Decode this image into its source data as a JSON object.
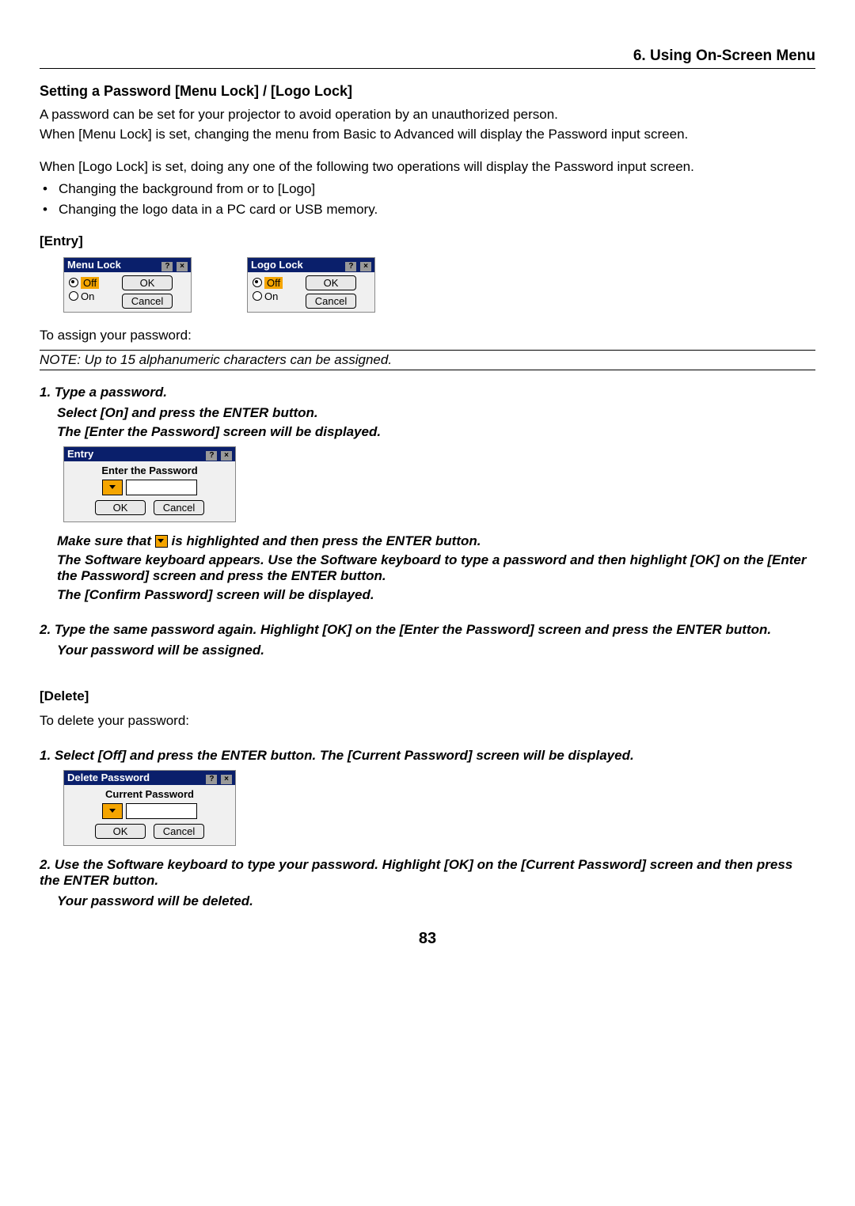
{
  "header": {
    "text": "6. Using On-Screen Menu"
  },
  "subtitle": "Setting a Password [Menu Lock] / [Logo Lock]",
  "intro": {
    "p1": "A password can be set for your projector to avoid operation by an unauthorized person.",
    "p2": "When [Menu Lock] is set, changing the menu from Basic to Advanced will display the Password input screen.",
    "p3": "When [Logo Lock] is set, doing any one of the following two operations will display the Password input screen."
  },
  "bullets": {
    "b1": "Changing the background from or to [Logo]",
    "b2": "Changing the logo data in a PC card or USB memory."
  },
  "entry_heading": "[Entry]",
  "dialogs": {
    "menu_lock": {
      "title": "Menu Lock",
      "off": "Off",
      "on": "On",
      "ok": "OK",
      "cancel": "Cancel"
    },
    "logo_lock": {
      "title": "Logo Lock",
      "off": "Off",
      "on": "On",
      "ok": "OK",
      "cancel": "Cancel"
    }
  },
  "assign_text": "To assign your password:",
  "note": "NOTE: Up to 15 alphanumeric characters can be assigned.",
  "step1": {
    "num": "1. Type a password.",
    "l1": "Select [On] and press the ENTER button.",
    "l2": "The [Enter the Password] screen will be displayed."
  },
  "entry_dialog": {
    "title": "Entry",
    "label": "Enter the Password",
    "ok": "OK",
    "cancel": "Cancel"
  },
  "after_entry": {
    "l1a": "Make sure that ",
    "l1b": " is highlighted and then press the ENTER button.",
    "l2": "The Software keyboard appears. Use the Software keyboard to type a password and then highlight [OK] on the [Enter the Password] screen and press the ENTER button.",
    "l3": "The [Confirm Password] screen will be displayed."
  },
  "step2": {
    "l1": "2. Type the same password again. Highlight [OK] on the [Enter the Password] screen and press the ENTER button.",
    "l2": "Your password will be assigned."
  },
  "delete_heading": "[Delete]",
  "delete_text": "To delete your password:",
  "delete_step1": "1. Select [Off] and press the ENTER button. The [Current Password] screen will be displayed.",
  "delete_dialog": {
    "title": "Delete Password",
    "label": "Current Password",
    "ok": "OK",
    "cancel": "Cancel"
  },
  "delete_step2": {
    "l1": "2. Use the Software keyboard to type your password. Highlight [OK] on the [Current Password] screen and then press the ENTER button.",
    "l2": "Your password will be deleted."
  },
  "page_number": "83"
}
